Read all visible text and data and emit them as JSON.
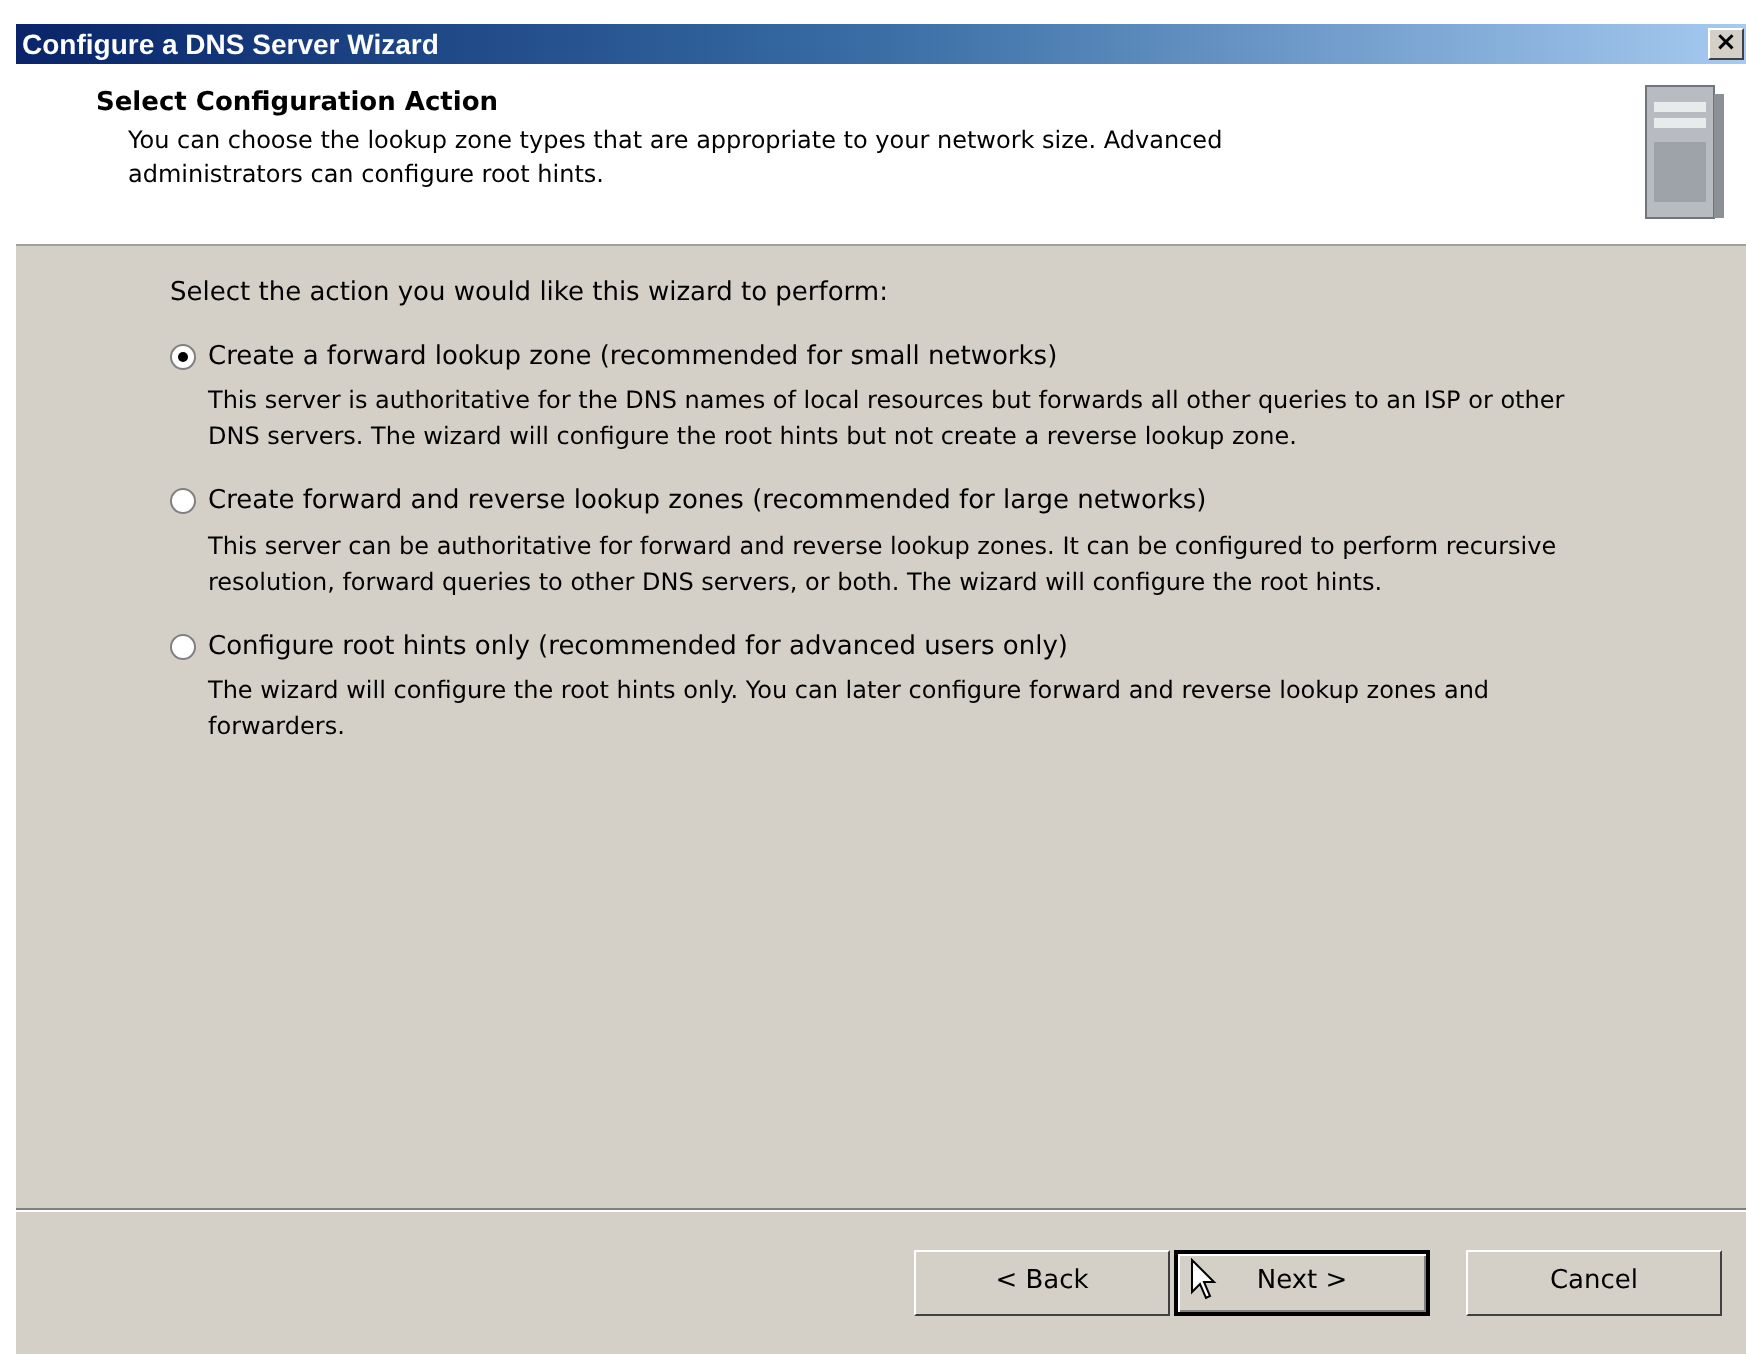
{
  "window": {
    "title": "Configure a DNS Server Wizard",
    "close": "×"
  },
  "header": {
    "title": "Select Configuration Action",
    "description": "You can choose the lookup zone types that are appropriate to your network size. Advanced administrators can configure root hints."
  },
  "prompt": "Select the action you would like this wizard to perform:",
  "options": [
    {
      "label": "Create a forward lookup zone (recommended for small networks)",
      "description": "This server is authoritative for the DNS names of local resources but forwards all other queries to an ISP or other DNS servers. The wizard will configure the root hints but not create a reverse lookup zone.",
      "selected": true
    },
    {
      "label": "Create forward and reverse lookup zones (recommended for large networks)",
      "description": "This server can be authoritative for forward and reverse lookup zones. It can be configured to perform recursive resolution, forward queries to other DNS servers, or both. The wizard will configure the root hints.",
      "selected": false
    },
    {
      "label": "Configure root hints only (recommended for advanced users only)",
      "description": "The wizard will configure the root hints only. You can later configure forward and reverse lookup zones and forwarders.",
      "selected": false
    }
  ],
  "buttons": [
    {
      "label": "< Back",
      "default": false
    },
    {
      "label": "Next >",
      "default": true
    },
    {
      "label": "Cancel",
      "default": false
    }
  ]
}
